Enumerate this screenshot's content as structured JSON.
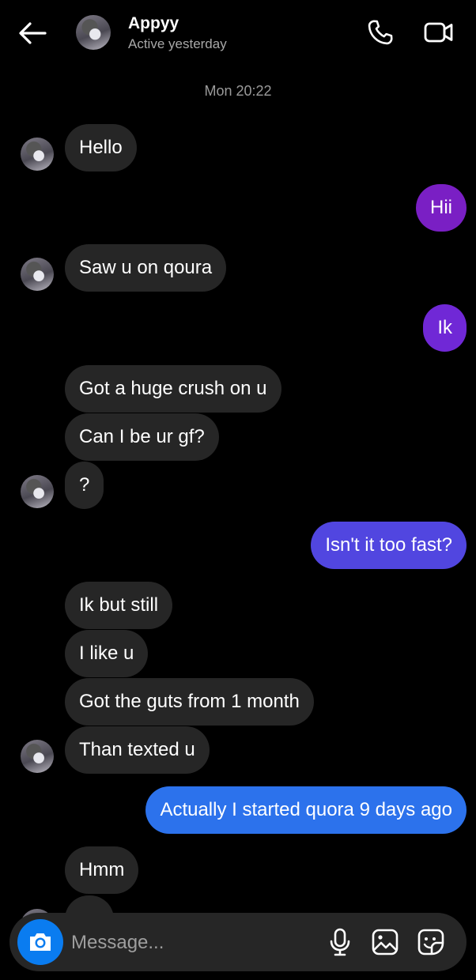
{
  "header": {
    "title": "Appyy",
    "status": "Active yesterday"
  },
  "timestamp": "Mon 20:22",
  "messages": [
    {
      "text": "Hello",
      "from": "them",
      "avatar": true
    },
    {
      "text": "Hii",
      "from": "me",
      "color": "#7a1fc4"
    },
    {
      "text": "Saw u on qoura",
      "from": "them",
      "avatar": true
    },
    {
      "text": "Ik",
      "from": "me",
      "color": "#7028d6"
    },
    {
      "text": "Got a huge crush on u",
      "from": "them",
      "avatar": false
    },
    {
      "text": "Can I be ur gf?",
      "from": "them",
      "avatar": false
    },
    {
      "text": "?",
      "from": "them",
      "avatar": true
    },
    {
      "text": "Isn't it too fast?",
      "from": "me",
      "color": "#5146e0"
    },
    {
      "text": "Ik but still",
      "from": "them",
      "avatar": false
    },
    {
      "text": "I like u",
      "from": "them",
      "avatar": false
    },
    {
      "text": "Got the guts from 1 month",
      "from": "them",
      "avatar": false
    },
    {
      "text": "Than texted u",
      "from": "them",
      "avatar": true
    },
    {
      "text": "Actually I started quora 9 days ago",
      "from": "me",
      "color": "#2c72ec"
    },
    {
      "text": "Hmm",
      "from": "them",
      "avatar": false
    }
  ],
  "composer": {
    "placeholder": "Message...",
    "icons": [
      "camera-icon",
      "microphone-icon",
      "gallery-icon",
      "sticker-icon"
    ]
  },
  "colors": {
    "background": "#000000",
    "incoming_bubble": "#262626",
    "camera_button": "#0a7cf0"
  }
}
